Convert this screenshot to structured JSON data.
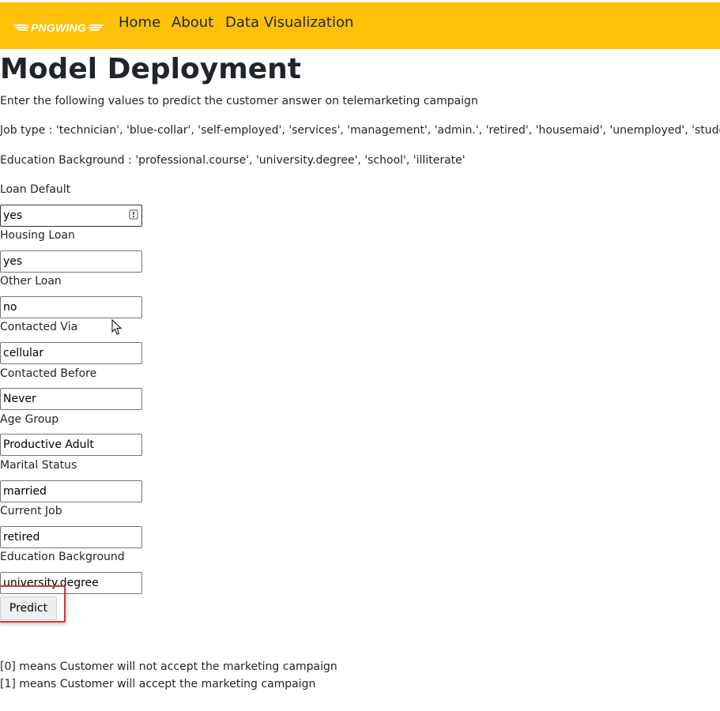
{
  "navbar": {
    "logo_text": "PNGWING",
    "links": [
      "Home",
      "About",
      "Data Visualization"
    ]
  },
  "page": {
    "title": "Model Deployment",
    "intro": "Enter the following values to predict the customer answer on telemarketing campaign",
    "job_types_note": "Job type : 'technician', 'blue-collar', 'self-employed', 'services', 'management', 'admin.', 'retired', 'housemaid', 'unemployed', 'student'",
    "education_note": "Education Background : 'professional.course', 'university.degree', 'school', 'illiterate'"
  },
  "form": {
    "fields": [
      {
        "label": "Loan Default",
        "value": "yes"
      },
      {
        "label": "Housing Loan",
        "value": "yes"
      },
      {
        "label": "Other Loan",
        "value": "no"
      },
      {
        "label": "Contacted Via",
        "value": "cellular"
      },
      {
        "label": "Contacted Before",
        "value": "Never"
      },
      {
        "label": "Age Group",
        "value": "Productive Adult"
      },
      {
        "label": "Marital Status",
        "value": "married"
      },
      {
        "label": "Current Job",
        "value": "retired"
      },
      {
        "label": "Education Background",
        "value": "university.degree"
      }
    ],
    "submit_label": "Predict"
  },
  "legend": {
    "zero": "[0] means Customer will not accept the marketing campaign",
    "one": "[1] means Customer will accept the marketing campaign"
  },
  "colors": {
    "navbar_bg": "#ffc107",
    "highlight": "#d9363e"
  },
  "icons": {
    "autofill": "password-manager-icon",
    "logo": "wing-logo-icon",
    "cursor": "mouse-cursor-icon"
  }
}
